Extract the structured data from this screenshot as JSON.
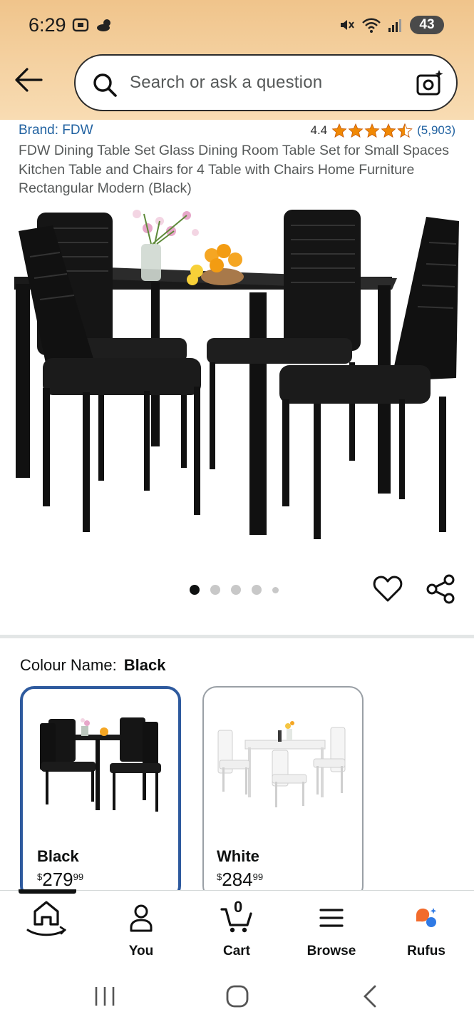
{
  "status_bar": {
    "time": "6:29",
    "battery": "43"
  },
  "search": {
    "placeholder": "Search or ask a question"
  },
  "product": {
    "brand": "Brand: FDW",
    "rating": "4.4",
    "rating_count": "(5,903)",
    "title": "FDW Dining Table Set Glass Dining Room Table Set for Small Spaces Kitchen Table and Chairs for 4 Table with Chairs Home Furniture Rectangular Modern (Black)",
    "carousel": {
      "total": 5,
      "active": 1
    }
  },
  "colour": {
    "label": "Colour Name:",
    "selected": "Black",
    "options": [
      {
        "name": "Black",
        "currency": "$",
        "whole": "279",
        "fraction": "99"
      },
      {
        "name": "White",
        "currency": "$",
        "whole": "284",
        "fraction": "99"
      }
    ]
  },
  "bottom_nav": {
    "items": [
      {
        "label": ""
      },
      {
        "label": "You"
      },
      {
        "label": "Cart",
        "badge": "0"
      },
      {
        "label": "Browse"
      },
      {
        "label": "Rufus"
      }
    ]
  },
  "colors": {
    "brand_blue": "#2162a1",
    "star_orange": "#f08804",
    "selected_border": "#2e5a9e",
    "header_bg": "#f0c48b"
  },
  "icons": [
    "arrow-left-icon",
    "search-icon",
    "camera-icon",
    "star-icon",
    "heart-icon",
    "share-icon",
    "home-icon",
    "user-icon",
    "cart-icon",
    "menu-icon",
    "rufus-icon"
  ]
}
